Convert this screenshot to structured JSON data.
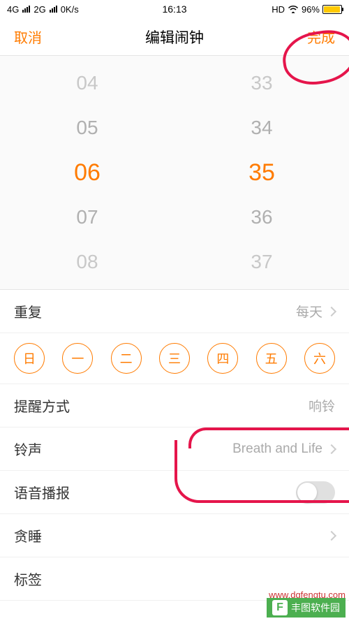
{
  "status": {
    "net1": "4G",
    "net2": "2G",
    "speed": "0K/s",
    "time": "16:13",
    "hd": "HD",
    "battery": "96%"
  },
  "nav": {
    "cancel": "取消",
    "title": "编辑闹钟",
    "done": "完成"
  },
  "picker": {
    "hours": [
      "04",
      "05",
      "06",
      "07",
      "08"
    ],
    "minutes": [
      "33",
      "34",
      "35",
      "36",
      "37"
    ],
    "selected_hour": "06",
    "selected_minute": "35"
  },
  "settings": {
    "repeat_label": "重复",
    "repeat_value": "每天",
    "days": [
      "日",
      "一",
      "二",
      "三",
      "四",
      "五",
      "六"
    ],
    "reminder_label": "提醒方式",
    "reminder_value": "响铃",
    "ringtone_label": "铃声",
    "ringtone_value": "Breath and Life",
    "voice_label": "语音播报",
    "voice_on": false,
    "snooze_label": "贪睡",
    "tag_label": "标签"
  },
  "watermark": {
    "name": "丰图软件园",
    "url": "www.dgfengtu.com"
  }
}
